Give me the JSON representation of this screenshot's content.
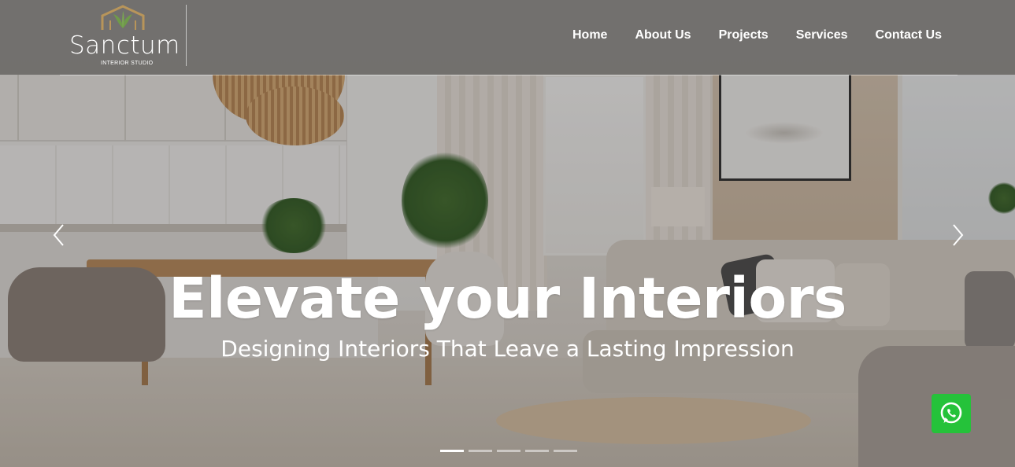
{
  "brand": {
    "name": "Sanctum",
    "tagline": "INTERIOR STUDIO",
    "logo_icon": "house-leaf-icon"
  },
  "nav": {
    "items": [
      {
        "label": "Home"
      },
      {
        "label": "About Us"
      },
      {
        "label": "Projects"
      },
      {
        "label": "Services"
      },
      {
        "label": "Contact Us"
      }
    ]
  },
  "hero": {
    "headline": "Elevate your Interiors",
    "subheadline": "Designing Interiors That Leave a Lasting Impression",
    "prev_icon": "chevron-left-icon",
    "next_icon": "chevron-right-icon",
    "slide_count": 5,
    "active_slide": 1
  },
  "whatsapp": {
    "icon": "whatsapp-icon",
    "color": "#25c23a"
  },
  "colors": {
    "header_overlay": "#4e4c4a",
    "text": "#ffffff",
    "logo_gold": "#b8955a"
  }
}
